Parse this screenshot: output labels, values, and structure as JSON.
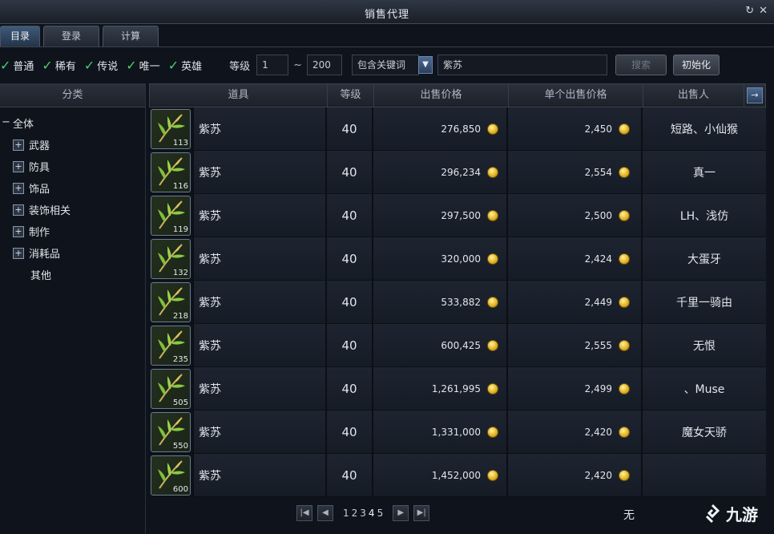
{
  "window": {
    "title": "销售代理",
    "ctrl_refresh": "↻",
    "ctrl_close": "✕"
  },
  "tabs": [
    {
      "label": "目录"
    },
    {
      "label": "登录"
    },
    {
      "label": "计算"
    }
  ],
  "filters": {
    "grades": [
      "普通",
      "稀有",
      "传说",
      "唯一",
      "英雄"
    ],
    "level_label": "等级",
    "level_min": "1",
    "level_max": "200",
    "sort_label": "包含关键词",
    "keyword": "紫苏",
    "search_label": "搜索",
    "reset_label": "初始化"
  },
  "sidebar": {
    "header": "分类",
    "root": "全体",
    "items": [
      "武器",
      "防具",
      "饰品",
      "装饰相关",
      "制作",
      "消耗品"
    ],
    "leaf": "其他"
  },
  "table": {
    "headers": {
      "item": "道具",
      "level": "等级",
      "price": "出售价格",
      "unit": "单个出售价格",
      "seller": "出售人"
    },
    "more": "→",
    "rows": [
      {
        "qty": "113",
        "name": "紫苏",
        "level": "40",
        "price": "276,850",
        "unit": "2,450",
        "seller": "短路、小仙猴"
      },
      {
        "qty": "116",
        "name": "紫苏",
        "level": "40",
        "price": "296,234",
        "unit": "2,554",
        "seller": "真一"
      },
      {
        "qty": "119",
        "name": "紫苏",
        "level": "40",
        "price": "297,500",
        "unit": "2,500",
        "seller": "LH、浅仿"
      },
      {
        "qty": "132",
        "name": "紫苏",
        "level": "40",
        "price": "320,000",
        "unit": "2,424",
        "seller": "大蛋牙"
      },
      {
        "qty": "218",
        "name": "紫苏",
        "level": "40",
        "price": "533,882",
        "unit": "2,449",
        "seller": "千里一骑由"
      },
      {
        "qty": "235",
        "name": "紫苏",
        "level": "40",
        "price": "600,425",
        "unit": "2,555",
        "seller": "无恨"
      },
      {
        "qty": "505",
        "name": "紫苏",
        "level": "40",
        "price": "1,261,995",
        "unit": "2,499",
        "seller": "、Muse"
      },
      {
        "qty": "550",
        "name": "紫苏",
        "level": "40",
        "price": "1,331,000",
        "unit": "2,420",
        "seller": "魔女天骄"
      },
      {
        "qty": "600",
        "name": "紫苏",
        "level": "40",
        "price": "1,452,000",
        "unit": "2,420",
        "seller": ""
      }
    ]
  },
  "pager": {
    "first": "|◀",
    "prev": "◀",
    "pages": [
      "1",
      "2",
      "3",
      "4",
      "5"
    ],
    "current": "4",
    "next": "▶",
    "last": "▶|"
  },
  "corner_text": "无",
  "watermark": "九游"
}
